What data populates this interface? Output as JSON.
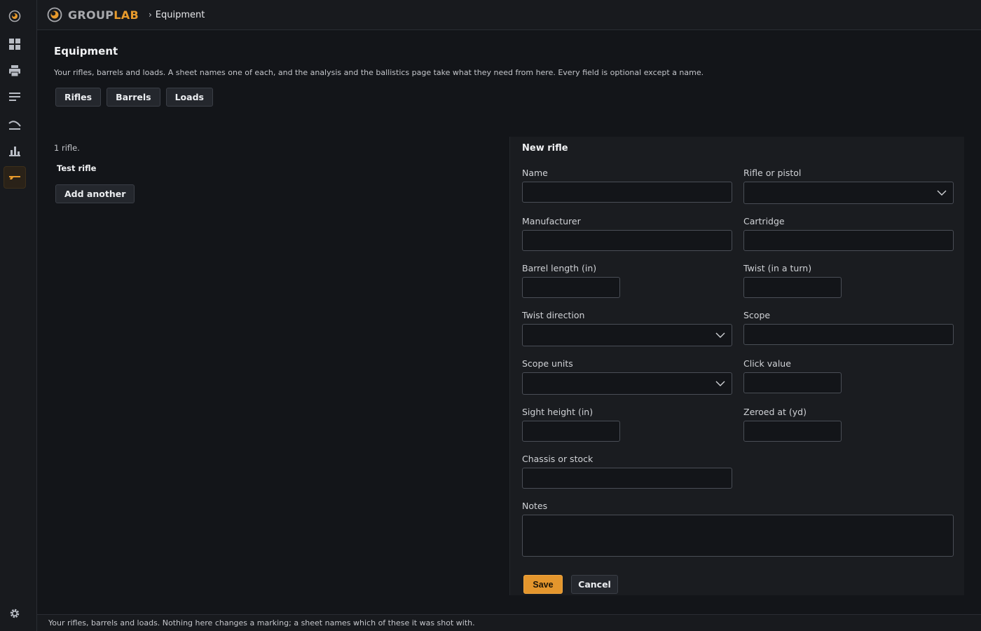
{
  "app": {
    "brand_part1": "GROUP",
    "brand_part2": "LAB",
    "breadcrumb_sep": "›",
    "breadcrumb": "Equipment",
    "accent_color": "#e79a2c"
  },
  "rail": {
    "items": [
      {
        "icon": "logo-icon"
      },
      {
        "icon": "dashboard-grid-icon"
      },
      {
        "icon": "printer-icon"
      },
      {
        "icon": "list-lines-icon"
      },
      {
        "icon": "trajectory-arc-icon"
      },
      {
        "icon": "bar-chart-icon"
      },
      {
        "icon": "rifle-icon",
        "active": true
      },
      {
        "icon": "gear-icon"
      }
    ]
  },
  "main": {
    "title": "Equipment",
    "description": "Your rifles, barrels and loads. A sheet names one of each, and the analysis and the ballistics page take what they need from here. Every field is optional except a name.",
    "tabs": [
      "Rifles",
      "Barrels",
      "Loads"
    ],
    "count_text": "1 rifle.",
    "rifles": [
      "Test rifle"
    ],
    "add_label": "Add another"
  },
  "form": {
    "title": "New rifle",
    "fields": {
      "name": {
        "label": "Name",
        "value": ""
      },
      "type": {
        "label": "Rifle or pistol",
        "value": ""
      },
      "manufacturer": {
        "label": "Manufacturer",
        "value": ""
      },
      "cartridge": {
        "label": "Cartridge",
        "value": ""
      },
      "barrel_length": {
        "label": "Barrel length (in)",
        "value": ""
      },
      "twist": {
        "label": "Twist (in a turn)",
        "value": ""
      },
      "twist_direction": {
        "label": "Twist direction",
        "value": ""
      },
      "scope": {
        "label": "Scope",
        "value": ""
      },
      "scope_units": {
        "label": "Scope units",
        "value": ""
      },
      "click_value": {
        "label": "Click value",
        "value": ""
      },
      "sight_height": {
        "label": "Sight height (in)",
        "value": ""
      },
      "zeroed_at": {
        "label": "Zeroed at (yd)",
        "value": ""
      },
      "chassis": {
        "label": "Chassis or stock",
        "value": ""
      },
      "notes": {
        "label": "Notes",
        "value": ""
      }
    },
    "save_label": "Save",
    "cancel_label": "Cancel"
  },
  "status": {
    "text": "Your rifles, barrels and loads. Nothing here changes a marking; a sheet names which of these it was shot with."
  }
}
